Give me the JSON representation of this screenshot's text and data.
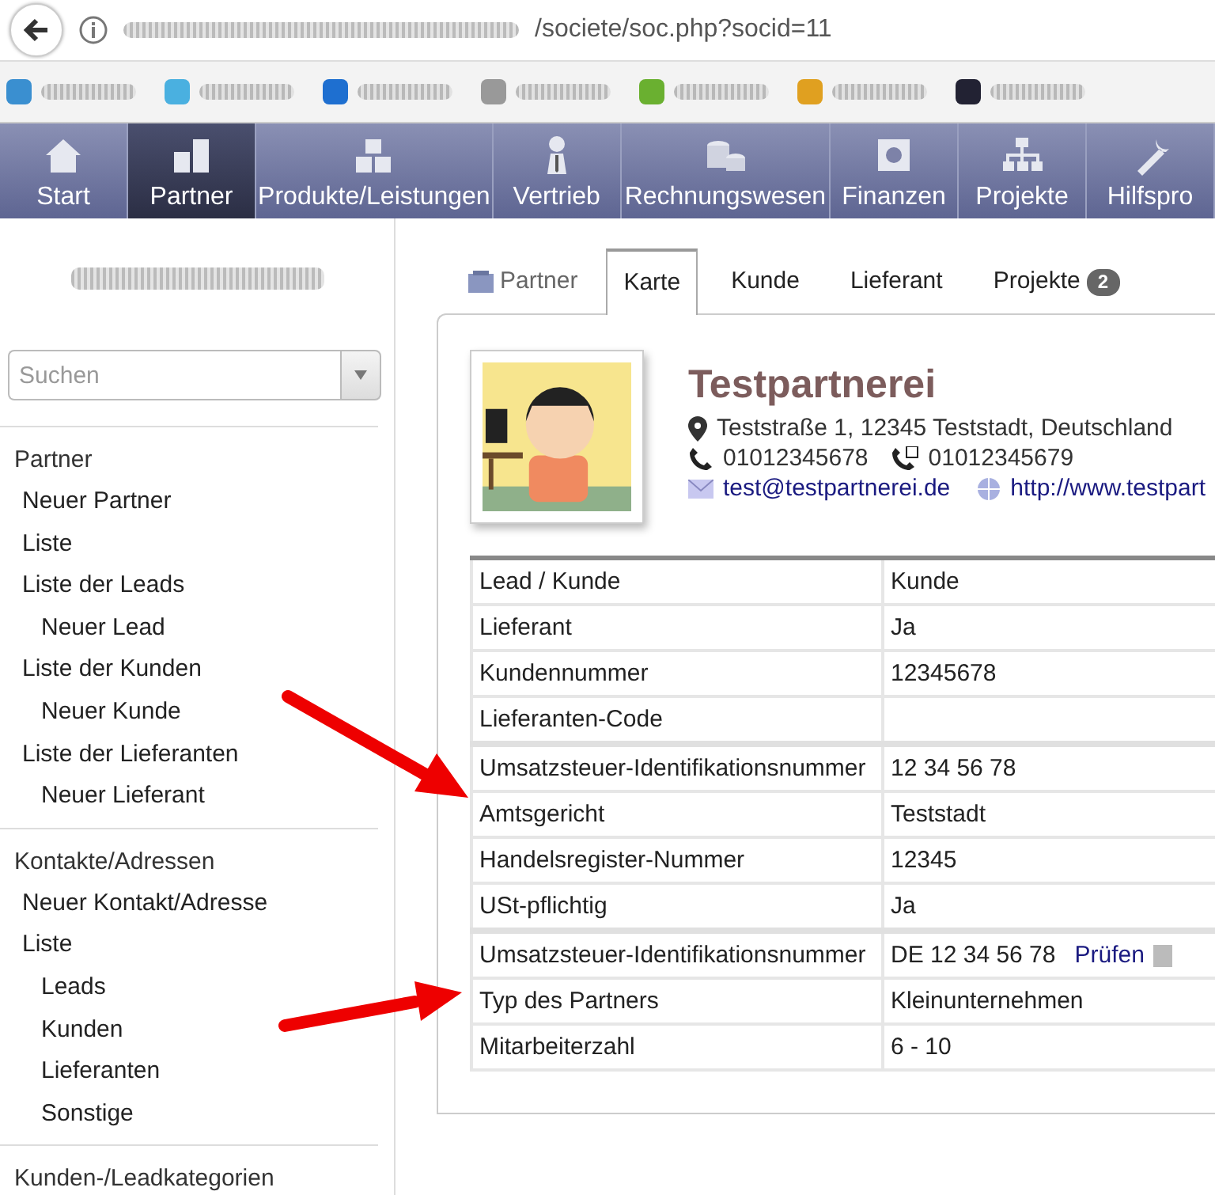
{
  "browser": {
    "url_path": "/societe/soc.php?socid=11"
  },
  "nav": [
    {
      "label": "Start",
      "selected": false
    },
    {
      "label": "Partner",
      "selected": true
    },
    {
      "label": "Produkte/Leistungen",
      "selected": false
    },
    {
      "label": "Vertrieb",
      "selected": false
    },
    {
      "label": "Rechnungswesen",
      "selected": false
    },
    {
      "label": "Finanzen",
      "selected": false
    },
    {
      "label": "Projekte",
      "selected": false
    },
    {
      "label": "Hilfspro",
      "selected": false
    }
  ],
  "sidebar": {
    "search": {
      "placeholder": "Suchen"
    },
    "sections": [
      {
        "title": "Partner",
        "items": [
          {
            "label": "Neuer Partner"
          },
          {
            "label": "Liste"
          },
          {
            "label": "Liste der Leads",
            "children": [
              {
                "label": "Neuer Lead"
              }
            ]
          },
          {
            "label": "Liste der Kunden",
            "children": [
              {
                "label": "Neuer Kunde"
              }
            ]
          },
          {
            "label": "Liste der Lieferanten",
            "children": [
              {
                "label": "Neuer Lieferant"
              }
            ]
          }
        ]
      },
      {
        "title": "Kontakte/Adressen",
        "items": [
          {
            "label": "Neuer Kontakt/Adresse"
          },
          {
            "label": "Liste",
            "children": [
              {
                "label": "Leads"
              },
              {
                "label": "Kunden"
              },
              {
                "label": "Lieferanten"
              },
              {
                "label": "Sonstige"
              }
            ]
          }
        ]
      },
      {
        "title": "Kunden-/Leadkategorien"
      }
    ]
  },
  "tabs": {
    "heading": "Partner",
    "items": [
      {
        "label": "Karte",
        "selected": true
      },
      {
        "label": "Kunde",
        "selected": false
      },
      {
        "label": "Lieferant",
        "selected": false
      },
      {
        "label": "Projekte",
        "badge": "2",
        "selected": false
      }
    ]
  },
  "company": {
    "name": "Testpartnerei",
    "address": "Teststraße 1, 12345 Teststadt, Deutschland",
    "phone": "01012345678",
    "fax": "01012345679",
    "email": "test@testpartnerei.de",
    "website": "http://www.testpart"
  },
  "details": [
    {
      "label": "Lead / Kunde",
      "value": "Kunde",
      "separator": false
    },
    {
      "label": "Lieferant",
      "value": "Ja",
      "separator": false
    },
    {
      "label": "Kundennummer",
      "value": "12345678",
      "separator": false
    },
    {
      "label": "Lieferanten-Code",
      "separator": false
    },
    {
      "label": "Umsatzsteuer-Identifikationsnummer",
      "value": "12 34 56 78",
      "separator": true
    },
    {
      "label": "Amtsgericht",
      "value": "Teststadt",
      "separator": false
    },
    {
      "label": "Handelsregister-Nummer",
      "value": "12345",
      "separator": false
    },
    {
      "label": "USt-pflichtig",
      "value": "Ja",
      "separator": false
    },
    {
      "label": "Umsatzsteuer-Identifikationsnummer",
      "value": "DE 12 34 56 78",
      "link": "Prüfen",
      "help": true,
      "separator": true
    },
    {
      "label": "Typ des Partners",
      "value": "Kleinunternehmen",
      "separator": false
    },
    {
      "label": "Mitarbeiterzahl",
      "value": "6 - 10",
      "separator": false
    }
  ]
}
